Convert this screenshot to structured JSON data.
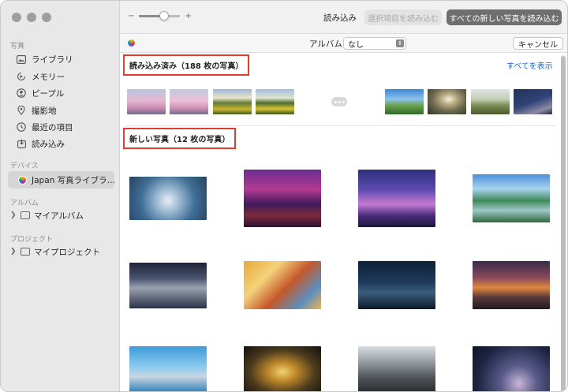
{
  "sidebar": {
    "section_photos": "写真",
    "items": [
      {
        "label": "ライブラリ",
        "icon": "photo-library-icon"
      },
      {
        "label": "メモリー",
        "icon": "memories-icon"
      },
      {
        "label": "ピープル",
        "icon": "people-icon"
      },
      {
        "label": "撮影地",
        "icon": "places-icon"
      },
      {
        "label": "最近の項目",
        "icon": "recents-icon"
      },
      {
        "label": "読み込み",
        "icon": "import-icon"
      }
    ],
    "section_devices": "デバイス",
    "device": "Japan 写真ライブラ…",
    "section_albums": "アルバム",
    "my_albums": "マイアルバム",
    "section_projects": "プロジェクト",
    "my_projects": "マイプロジェクト"
  },
  "toolbar": {
    "zoom_minus": "−",
    "zoom_plus": "+",
    "zoom_level": 0.6,
    "import_label": "読み込み",
    "import_selected": "選択項目を読み込む",
    "import_all_new": "すべての新しい写真を読み込む"
  },
  "subbar": {
    "album_label": "アルバム:",
    "album_value": "なし",
    "cancel": "キャンセル"
  },
  "content": {
    "imported_title": "読み込み済み（188 枚の写真）",
    "show_all": "すべてを表示",
    "new_title": "新しい写真（12 枚の写真）"
  },
  "colors": {
    "accent_blue": "#1a66d2",
    "highlight_red": "#e33b2e",
    "primary_button": "#6f6f6f"
  }
}
